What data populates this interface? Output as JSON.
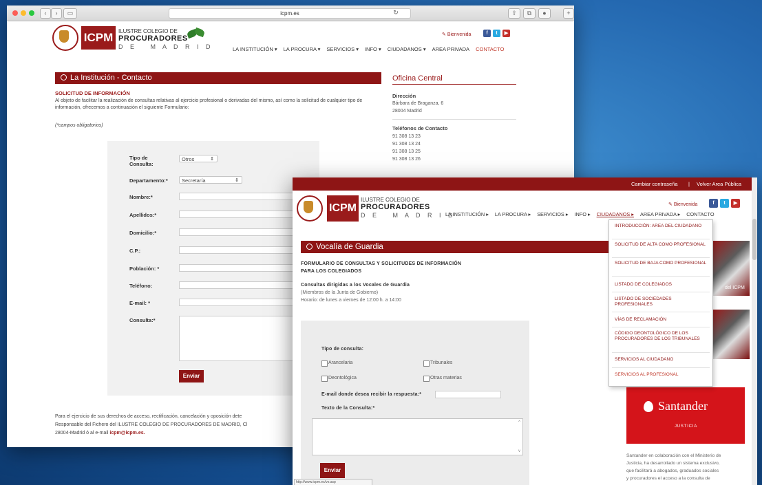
{
  "back_window": {
    "url": "icpm.es",
    "logo": {
      "line1": "ILUSTRE COLEGIO DE",
      "line2": "PROCURADORES",
      "line3": "D E   M A D R I D",
      "box": "ICPM"
    },
    "bienvenida": "Bienvenida",
    "nav": [
      "LA INSTITUCIÓN ▾",
      "LA PROCURA ▾",
      "SERVICIOS ▾",
      "INFO ▾",
      "CIUDADANOS ▾",
      "AREA PRIVADA",
      "CONTACTO"
    ],
    "section_title": "La Institución - Contacto",
    "request_title": "SOLICITUD DE INFORMACIÓN",
    "intro": "Al objeto de facilitar la realización de consultas relativas al ejercicio profesional o derivadas del mismo, así como la solicitud de cualquier tipo de información, ofrecemos a continuación el siguiente Formulario:",
    "required_note": "(*campos obligatorios)",
    "sidebar": {
      "title": "Oficina Central",
      "address_label": "Dirección",
      "address_lines": [
        "Bárbara de Braganza, 6",
        "28004 Madrid"
      ],
      "phones_label": "Teléfonos de Contacto",
      "phones": [
        "91 308 13 23",
        "91 308 13 24",
        "91 308 13 25",
        "91 308 13 26"
      ]
    },
    "form": {
      "tipo_label": "Tipo de Consulta:",
      "tipo_value": "Otros",
      "depto_label": "Departamento:*",
      "depto_value": "Secretaría",
      "fields": [
        "Nombre:*",
        "Apellidos:*",
        "Domicilio:*",
        "C.P.:",
        "Población: *",
        "Teléfono:",
        "E-mail: *",
        "Consulta:*"
      ],
      "submit": "Enviar"
    },
    "footer_line1": "Para el ejercicio de sus derechos de acceso, rectificación, cancelación y oposición dete",
    "footer_line2": "Responsable del Fichero del ILUSTRE COLEGIO DE PROCURADORES DE MADRID, Cl",
    "footer_line3_prefix": "28004-Madrid ó al e-mail ",
    "footer_email": "icpm@icpm.es."
  },
  "front_window": {
    "top_links": [
      "Cambiar contraseña",
      "|",
      "Volver Area Pública"
    ],
    "logo": {
      "line1": "ILUSTRE COLEGIO DE",
      "line2": "PROCURADORES",
      "line3": "D E   M A D R I D",
      "box": "ICPM"
    },
    "bienvenida": "Bienvenida",
    "nav": [
      "LA INSTITUCIÓN ▸",
      "LA PROCURA ▸",
      "SERVICIOS ▸",
      "INFO ▸",
      "CIUDADANOS ▸",
      "AREA PRIVADA ▸",
      "CONTACTO"
    ],
    "dropdown": [
      "INTRODUCCIÓN: AREA DEL CIUDADANO",
      "SOLICITUD DE ALTA COMO PROFESIONAL",
      "SOLICITUD DE BAJA COMO PROFESIONAL",
      "LISTADO DE COLEGIADOS",
      "LISTADO DE SOCIEDADES PROFESIONALES",
      "VÍAS DE RECLAMACIÓN",
      "CÓDIGO DEONTOLÓGICO DE LOS PROCURADORES DE LOS TRIBUNALES",
      "SERVICIOS AL CIUDADANO",
      "SERVICIOS AL PROFESIONAL"
    ],
    "section_title": "Vocalía de Guardia",
    "form_title_1": "FORMULARIO DE CONSULTAS Y SOLICITUDES DE INFORMACIÓN",
    "form_title_2": "PARA LOS COLEGIADOS",
    "consultas_title": "Consultas dirigidas a los Vocales de Guardia",
    "consultas_sub": "(Miembros de la Junta de Gobierno)",
    "horario": "Horario: de lunes a viernes de 12:00 h. a 14:00",
    "tipo_label": "Tipo de consulta:",
    "checkboxes": [
      "Arancelaria",
      "Tribunales",
      "Deontológica",
      "Otras materias"
    ],
    "email_label": "E-mail donde desea recibir la respuesta:*",
    "texto_label": "Texto de la Consulta:*",
    "submit": "Enviar",
    "photo_caption": "del ICPM",
    "santander_brand": "Santander",
    "santander_sub": "JUSTICIA",
    "santander_text": [
      "Santander en colaboración con el Ministerio de",
      "Justicia, ha desarrollado un sistema exclusivo,",
      "que facilitará a abogados, graduados sociales",
      "y procuradores el acceso a la consulta de"
    ],
    "status_url": "http://www.icpm.es/vo.asp"
  }
}
